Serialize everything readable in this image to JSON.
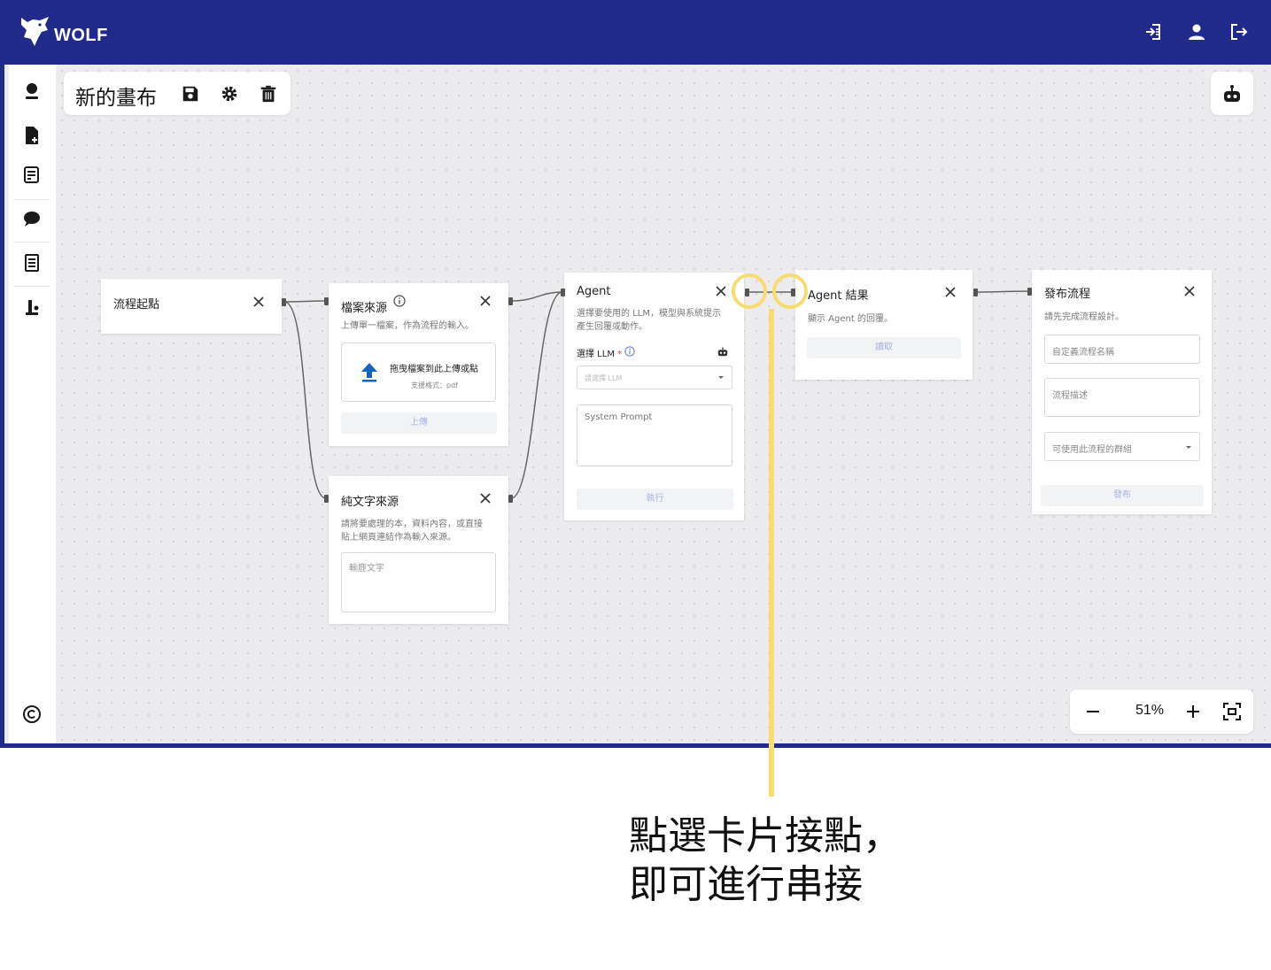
{
  "header": {
    "app_name": "WOLF"
  },
  "toolbar": {
    "title": "新的畫布"
  },
  "nodes": {
    "start": {
      "title": "流程起點"
    },
    "file": {
      "title": "檔案來源",
      "desc": "上傳單一檔案，作為流程的輸入。",
      "drop_text": "拖曳檔案到此上傳或點",
      "formats": "支援格式：pdf",
      "button": "上傳"
    },
    "text": {
      "title": "純文字來源",
      "desc_line1": "請將要處理的本，資料內容，或直接",
      "desc_line2": "貼上網頁連結作為輸入來源。",
      "placeholder": "輸鹿文字"
    },
    "agent": {
      "title": "Agent",
      "desc_line1": "選擇要使用的 LLM，模型與系統提示",
      "desc_line2": "產生回覆或動作。",
      "llm_label": "選擇 LLM",
      "required_mark": "*",
      "llm_placeholder": "請選擇 LLM",
      "prompt_placeholder": "System Prompt",
      "button": "執行"
    },
    "result": {
      "title": "Agent 結果",
      "desc": "顯示 Agent 的回覆。",
      "button": "讀取"
    },
    "publish": {
      "title": "發布流程",
      "desc": "請先完成流程設計。",
      "name_placeholder": "自定義流程名稱",
      "desc_placeholder": "流程描述",
      "group_placeholder": "可使用此流程的群組",
      "button": "發布"
    }
  },
  "zoom": {
    "level": "51%"
  },
  "annotation": {
    "line1": "點選卡片接點，",
    "line2": "即可進行串接"
  },
  "colors": {
    "header": "#1f2a8a",
    "highlight": "#f7dc6f",
    "canvas": "#ececee"
  },
  "icons": [
    "wolf-logo",
    "flow-exit-icon",
    "user-icon",
    "logout-icon",
    "avatar-icon",
    "file-add-icon",
    "note-add-icon",
    "chat-icon",
    "document-icon",
    "flow-icon",
    "copyright-icon",
    "save-icon",
    "gear-icon",
    "trash-icon",
    "robot-icon",
    "upload-icon",
    "info-icon",
    "chevron-down-icon",
    "close-icon",
    "zoom-out-icon",
    "zoom-in-icon",
    "fit-view-icon"
  ]
}
